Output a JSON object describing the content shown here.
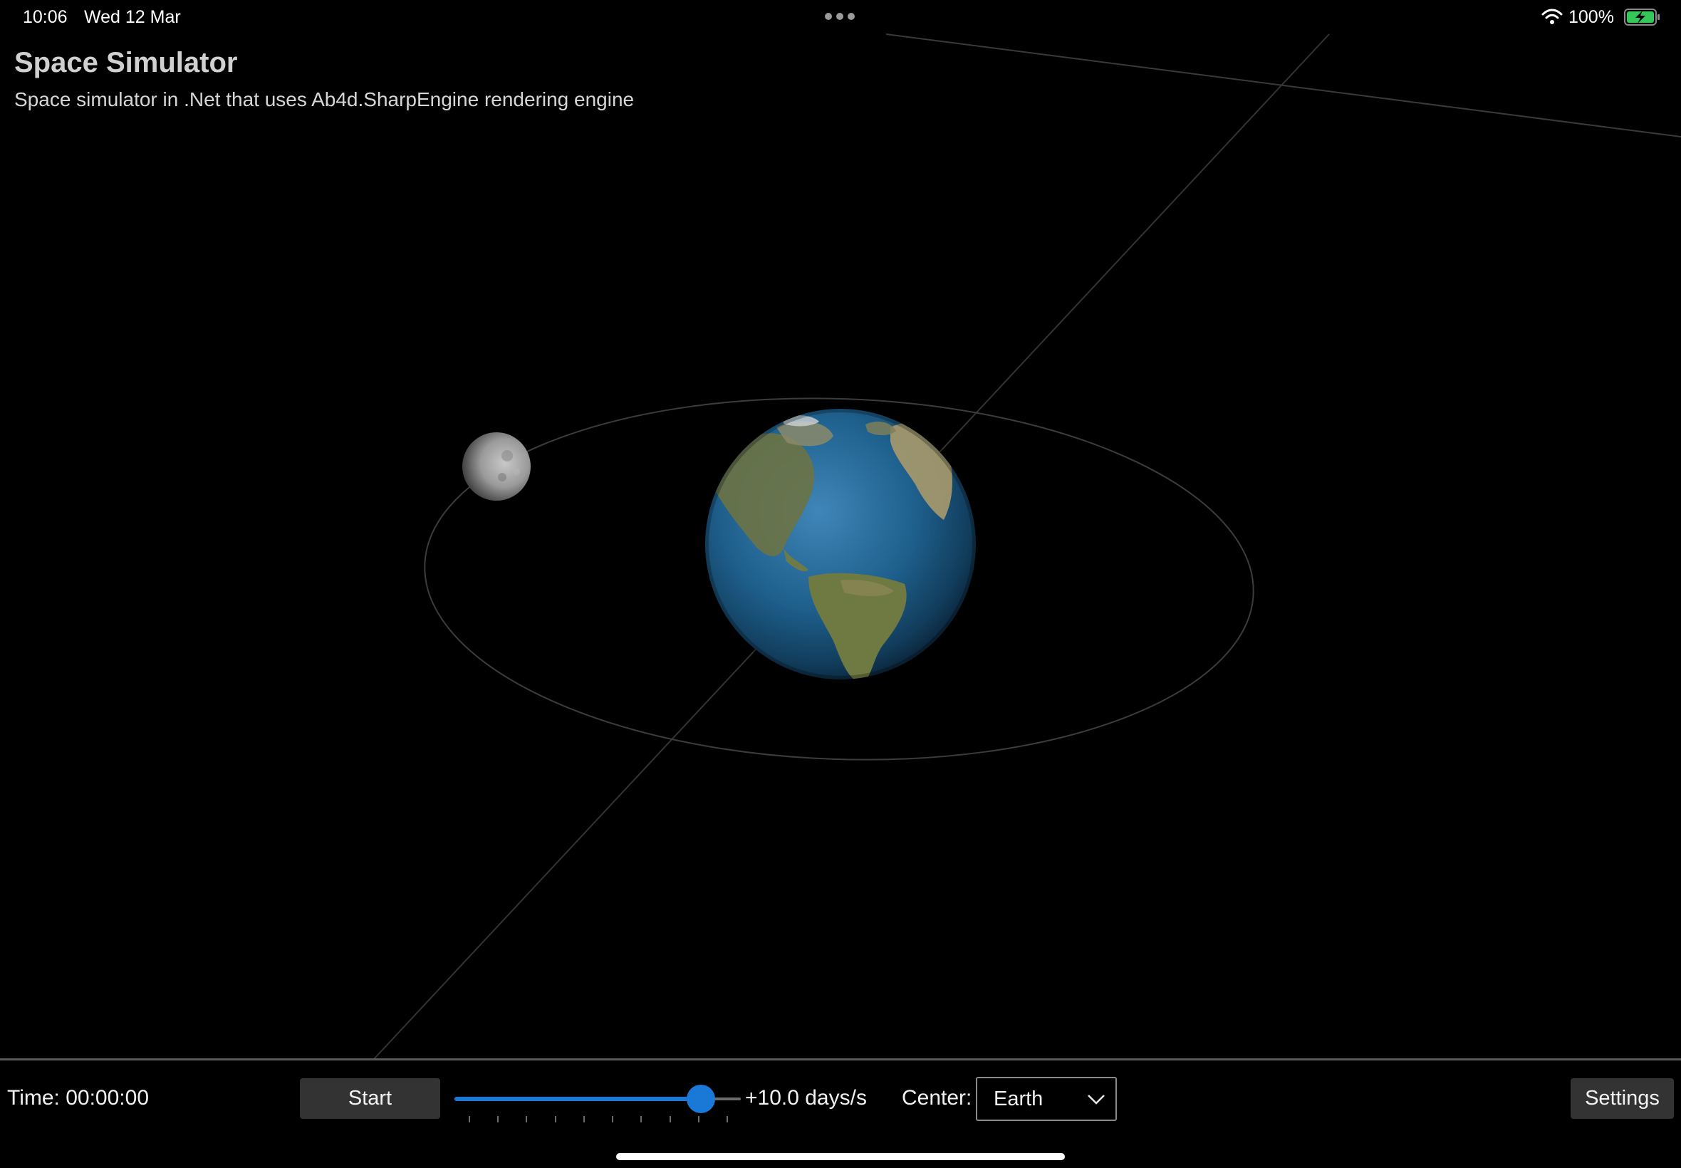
{
  "status_bar": {
    "time": "10:06",
    "date": "Wed 12 Mar",
    "battery_percent": "100%",
    "wifi_icon": "wifi-icon",
    "battery_icon": "battery-charging-icon"
  },
  "header": {
    "title": "Space Simulator",
    "subtitle": "Space simulator in .Net that uses Ab4d.SharpEngine rendering engine"
  },
  "scene": {
    "bodies": [
      "earth",
      "moon"
    ],
    "orbit_color": "#3c3c3c",
    "axis_color": "#3a3a3a"
  },
  "toolbar": {
    "time_label": "Time: 00:00:00",
    "start_label": "Start",
    "speed_slider": {
      "value_fraction": 0.86,
      "tick_count": 10,
      "accent": "#1a78d6"
    },
    "speed_label": "+10.0 days/s",
    "center_label": "Center:",
    "center_value": "Earth",
    "settings_label": "Settings"
  }
}
